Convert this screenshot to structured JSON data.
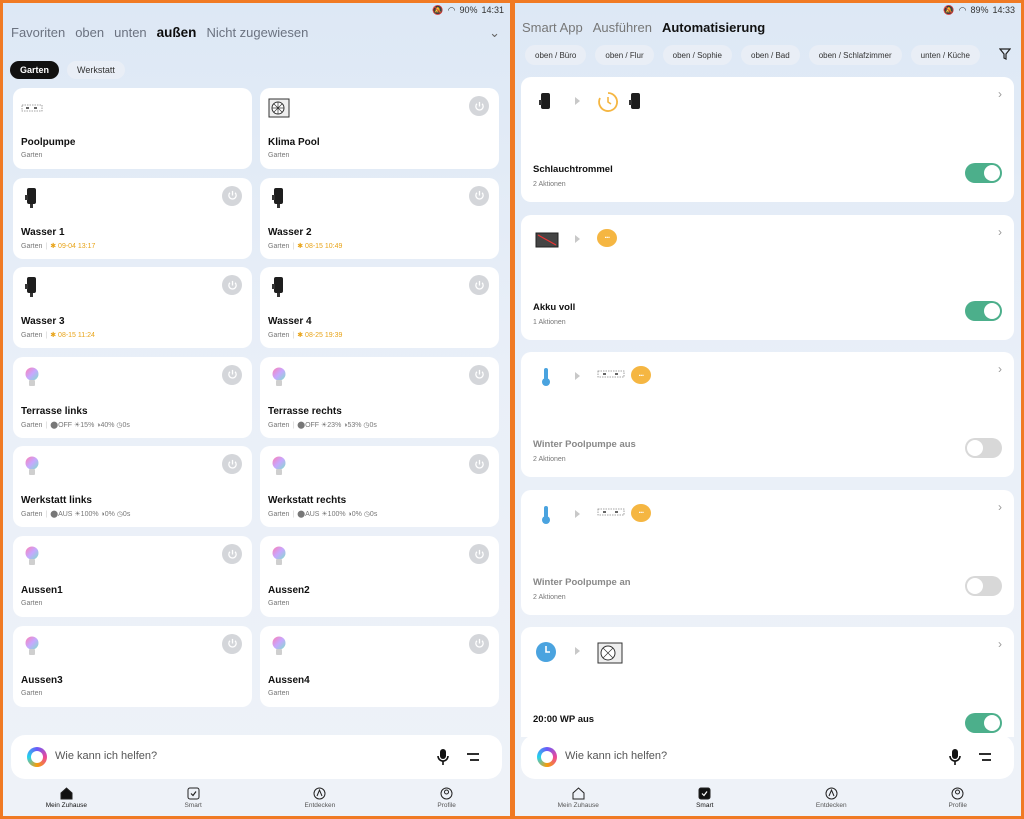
{
  "left": {
    "status": {
      "battery": "90%",
      "time": "14:31"
    },
    "tabs": [
      "Favoriten",
      "oben",
      "unten",
      "außen",
      "Nicht zugewiesen"
    ],
    "active_tab": "außen",
    "chips": [
      "Garten",
      "Werkstatt"
    ],
    "devices": [
      {
        "name": "Poolpumpe",
        "room": "Garten",
        "icon": "socket-strip-icon",
        "power": false,
        "extra": ""
      },
      {
        "name": "Klima Pool",
        "room": "Garten",
        "icon": "heat-pump-icon",
        "power": true,
        "extra": ""
      },
      {
        "name": "Wasser 1",
        "room": "Garten",
        "icon": "water-valve-icon",
        "power": true,
        "extra": "09-04 13:17"
      },
      {
        "name": "Wasser 2",
        "room": "Garten",
        "icon": "water-valve-icon",
        "power": true,
        "extra": "08-15 10:49"
      },
      {
        "name": "Wasser 3",
        "room": "Garten",
        "icon": "water-valve-icon",
        "power": true,
        "extra": "08-15 11:24"
      },
      {
        "name": "Wasser 4",
        "room": "Garten",
        "icon": "water-valve-icon",
        "power": true,
        "extra": "08-25 19:39"
      },
      {
        "name": "Terrasse links",
        "room": "Garten",
        "icon": "bulb-icon",
        "power": true,
        "extra": "⬤OFF ☀15% ◑40% ◷0s"
      },
      {
        "name": "Terrasse rechts",
        "room": "Garten",
        "icon": "bulb-icon",
        "power": true,
        "extra": "⬤OFF ☀23% ◑53% ◷0s"
      },
      {
        "name": "Werkstatt links",
        "room": "Garten",
        "icon": "bulb-icon",
        "power": true,
        "extra": "⬤AUS ☀100% ◑0% ◷0s"
      },
      {
        "name": "Werkstatt rechts",
        "room": "Garten",
        "icon": "bulb-icon",
        "power": true,
        "extra": "⬤AUS ☀100% ◑0% ◷0s"
      },
      {
        "name": "Aussen1",
        "room": "Garten",
        "icon": "bulb-icon",
        "power": true,
        "extra": ""
      },
      {
        "name": "Aussen2",
        "room": "Garten",
        "icon": "bulb-icon",
        "power": true,
        "extra": ""
      },
      {
        "name": "Aussen3",
        "room": "Garten",
        "icon": "bulb-icon",
        "power": true,
        "extra": ""
      },
      {
        "name": "Aussen4",
        "room": "Garten",
        "icon": "bulb-icon",
        "power": true,
        "extra": ""
      }
    ],
    "assistant_placeholder": "Wie kann ich helfen?",
    "nav": [
      "Mein Zuhause",
      "Smart",
      "Entdecken",
      "Profile"
    ],
    "nav_active": 0
  },
  "right": {
    "status": {
      "battery": "89%",
      "time": "14:33"
    },
    "tabs": [
      "Smart App",
      "Ausführen",
      "Automatisierung"
    ],
    "active_tab": "Automatisierung",
    "rooms": [
      "oben / Büro",
      "oben / Flur",
      "oben / Sophie",
      "oben / Bad",
      "oben / Schlafzimmer",
      "unten / Küche"
    ],
    "automations": [
      {
        "name": "Schlauchtrommel",
        "actions": "2 Aktionen",
        "enabled": true
      },
      {
        "name": "Akku voll",
        "actions": "1 Aktionen",
        "enabled": true
      },
      {
        "name": "Winter Poolpumpe aus",
        "actions": "2 Aktionen",
        "enabled": false
      },
      {
        "name": "Winter Poolpumpe an",
        "actions": "2 Aktionen",
        "enabled": false
      },
      {
        "name": "20:00 WP aus",
        "actions": "",
        "enabled": true
      }
    ],
    "assistant_placeholder": "Wie kann ich helfen?",
    "nav": [
      "Mein Zuhause",
      "Smart",
      "Entdecken",
      "Profile"
    ],
    "nav_active": 1
  },
  "colors": {
    "accent_green": "#4caf8b",
    "timer_orange": "#e8a317",
    "frame": "#f07a24"
  }
}
